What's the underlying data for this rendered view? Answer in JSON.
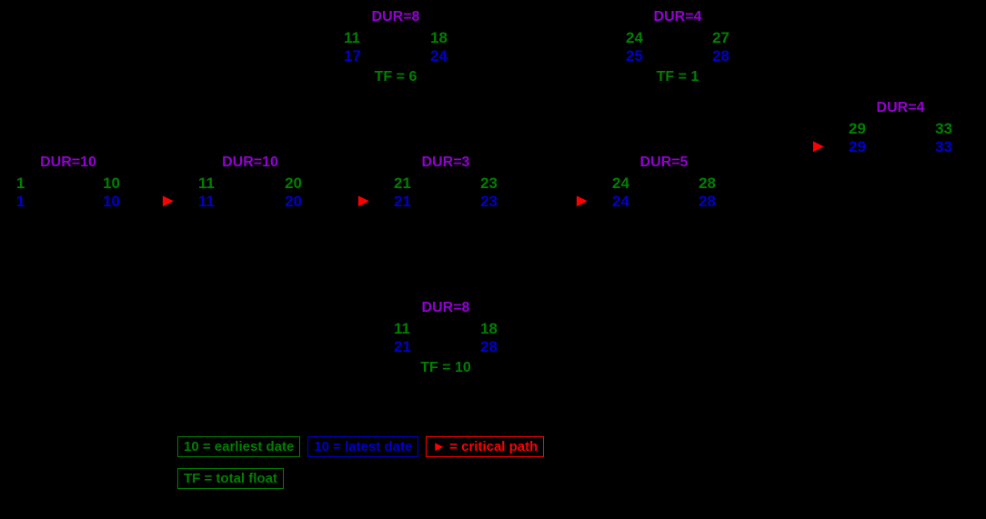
{
  "nodes": {
    "n1": {
      "dur": "DUR=10",
      "es": "1",
      "ef": "10",
      "ls": "1",
      "lf": "10",
      "tf": ""
    },
    "n2": {
      "dur": "DUR=10",
      "es": "11",
      "ef": "20",
      "ls": "11",
      "lf": "20",
      "tf": ""
    },
    "n3top": {
      "dur": "DUR=8",
      "es": "11",
      "ef": "18",
      "ls": "17",
      "lf": "24",
      "tf": "TF = 6"
    },
    "n3mid": {
      "dur": "DUR=3",
      "es": "21",
      "ef": "23",
      "ls": "21",
      "lf": "23",
      "tf": ""
    },
    "n3bot": {
      "dur": "DUR=8",
      "es": "11",
      "ef": "18",
      "ls": "21",
      "lf": "28",
      "tf": "TF = 10"
    },
    "n4top": {
      "dur": "DUR=4",
      "es": "24",
      "ef": "27",
      "ls": "25",
      "lf": "28",
      "tf": "TF = 1"
    },
    "n4mid": {
      "dur": "DUR=5",
      "es": "24",
      "ef": "28",
      "ls": "24",
      "lf": "28",
      "tf": ""
    },
    "n5": {
      "dur": "DUR=4",
      "es": "29",
      "ef": "33",
      "ls": "29",
      "lf": "33",
      "tf": ""
    }
  },
  "legend": {
    "earliest": "10 = earliest date",
    "latest": "10 = latest date",
    "critical": "= critical path",
    "totalfloat": "TF = total float"
  }
}
